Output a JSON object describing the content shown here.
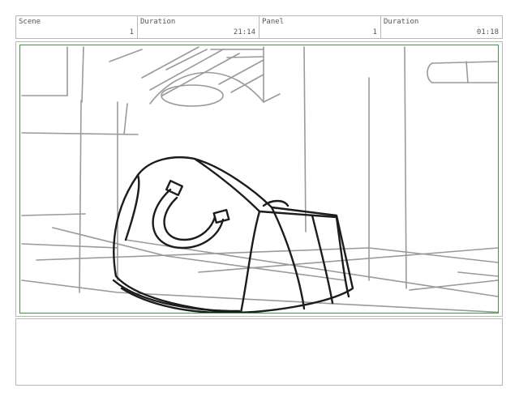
{
  "header": {
    "scene_label": "Scene",
    "scene_value": "1",
    "scene_duration_label": "Duration",
    "scene_duration_value": "21:14",
    "panel_label": "Panel",
    "panel_value": "1",
    "panel_duration_label": "Duration",
    "panel_duration_value": "01:18"
  },
  "frame": {
    "border_color": "#3a9a3a",
    "subject": "duffel-bag-sketch"
  },
  "notes": {
    "text": ""
  }
}
